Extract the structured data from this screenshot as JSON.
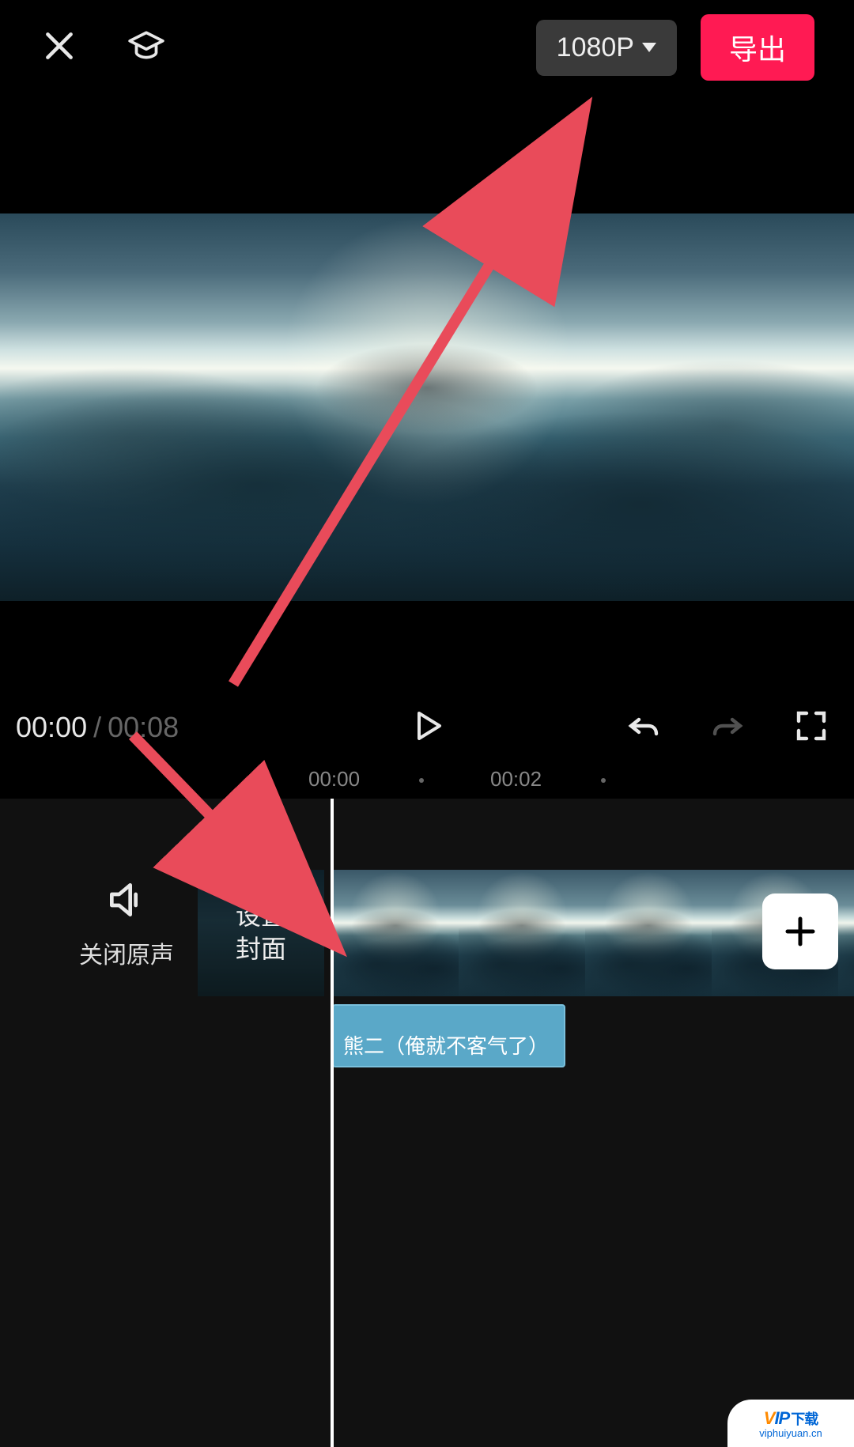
{
  "header": {
    "resolution_label": "1080P",
    "export_label": "导出"
  },
  "playback": {
    "current_time": "00:00",
    "separator": "/",
    "total_time": "00:08"
  },
  "ruler": {
    "ticks": [
      "00:00",
      "00:02"
    ]
  },
  "timeline": {
    "mute_label": "关闭原声",
    "cover_label": "设置\n封面",
    "caption_text": "熊二（俺就不客气了）"
  },
  "watermark": {
    "brand_v": "V",
    "brand_ip": "IP",
    "brand_suffix": "下载",
    "url": "viphuiyuan.cn"
  },
  "colors": {
    "accent": "#ff1a53",
    "caption_bg": "#5aa8c8"
  }
}
